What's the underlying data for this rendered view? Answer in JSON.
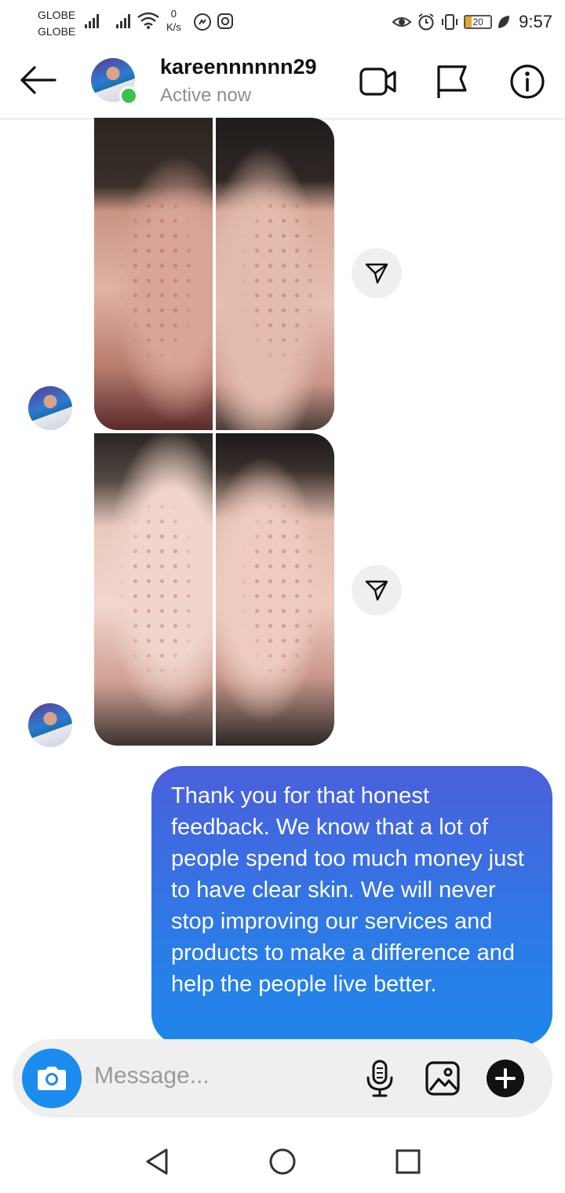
{
  "status_bar": {
    "carrier_1": "GLOBE",
    "carrier_2": "GLOBE",
    "speed_value": "0",
    "speed_unit": "K/s",
    "battery": "20",
    "time": "9:57"
  },
  "header": {
    "username": "kareennnnnn29",
    "status": "Active now"
  },
  "messages": [
    {
      "type": "image",
      "from": "kareennnnnn29"
    },
    {
      "type": "image",
      "from": "kareennnnnn29"
    },
    {
      "type": "text",
      "from": "me",
      "text": "Thank you for that honest feedback. We know that a lot of people spend too much money just to have clear skin. We will never stop improving our services and products to make a difference and help the people live better."
    }
  ],
  "composer": {
    "placeholder": "Message..."
  },
  "colors": {
    "accent": "#1a8cf0",
    "online": "#3bc24f",
    "bubble_top": "#4b5fdc",
    "bubble_bottom": "#1f86ea"
  }
}
